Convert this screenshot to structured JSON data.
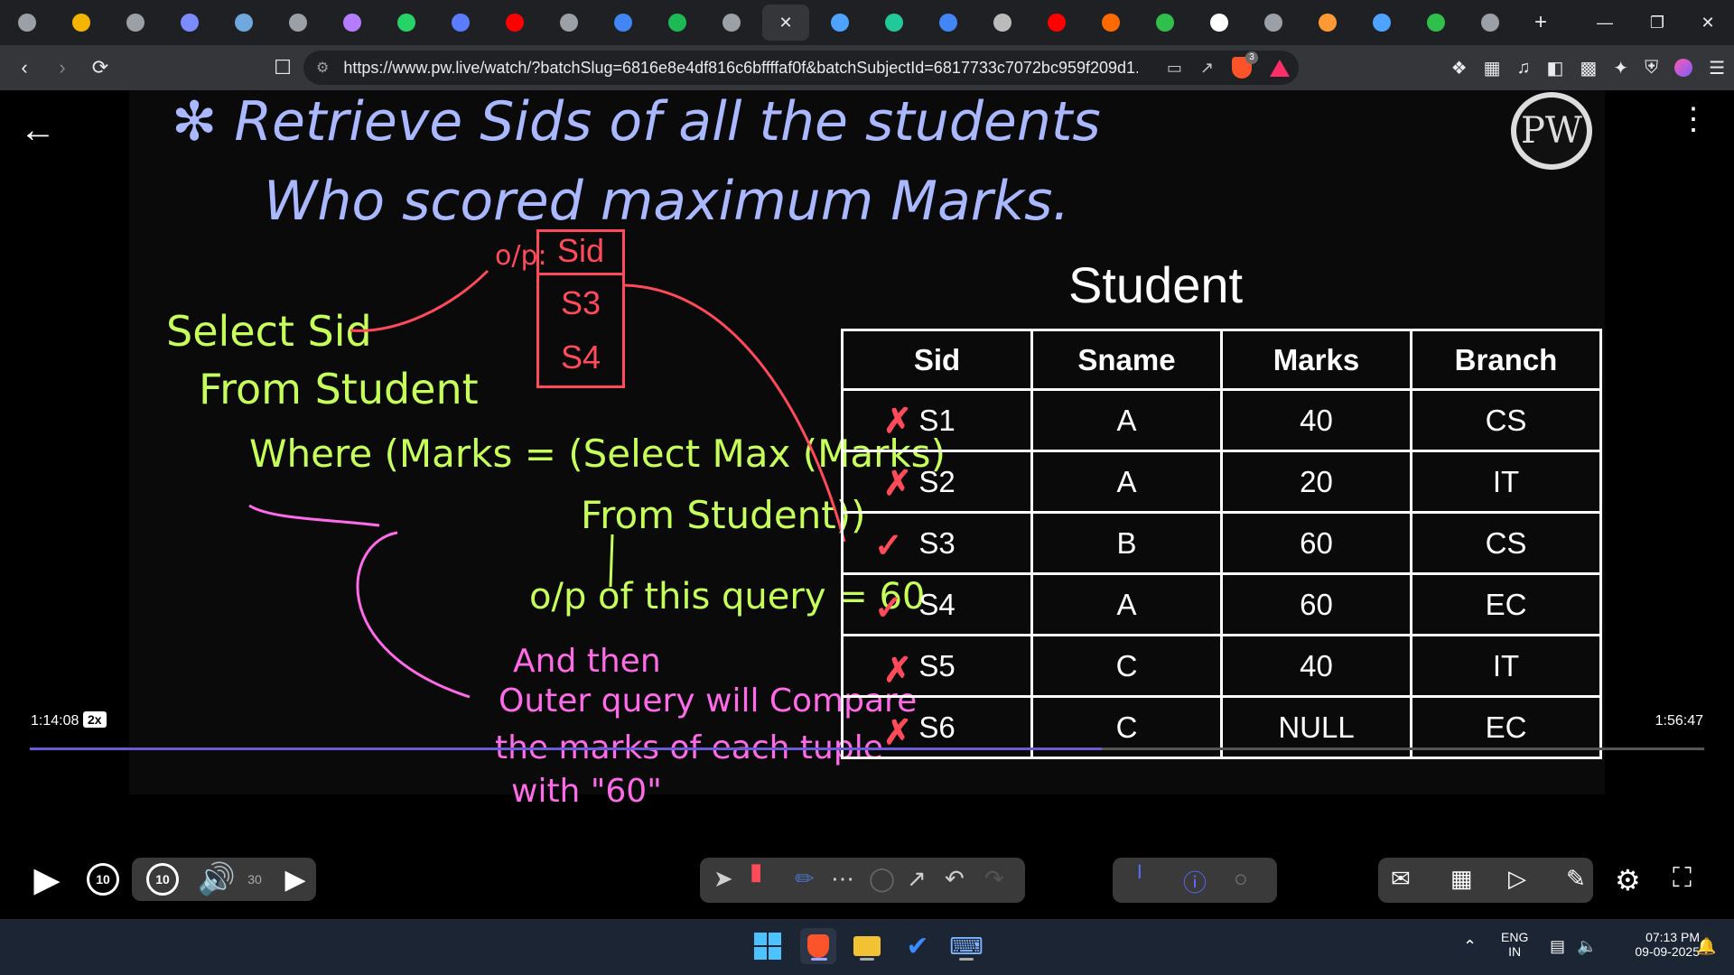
{
  "browser": {
    "tab_colors": [
      "#9aa0a6",
      "#f5b400",
      "#9aa0a6",
      "#7c8cff",
      "#6fa8dc",
      "#9aa0a6",
      "#b57cff",
      "#25d366",
      "#5b7cff",
      "#ff0000",
      "#9aa0a6",
      "#4285f4",
      "#1db954",
      "#9aa0a6"
    ],
    "active_tab_close": "✕",
    "tab_colors_right": [
      "#4da3ff",
      "#20c997",
      "#4285f4",
      "#bbbbbb",
      "#ff0000",
      "#ff6a00",
      "#2fbf4a",
      "#ffffff",
      "#9aa0a6",
      "#ff9933",
      "#4da3ff",
      "#2fbf4a",
      "#9aa0a6"
    ],
    "new_tab": "+",
    "window_controls": {
      "minimize": "—",
      "restore": "❐",
      "close": "✕"
    },
    "url": "https://www.pw.live/watch/?batchSlug=6816e8e4df816c6bffffaf0f&batchSubjectId=6817733c7072bc959f209d1...",
    "brave_badge": "3"
  },
  "lecture": {
    "heading_line1": "✻ Retrieve Sids of all the students",
    "heading_line2": "Who scored maximum Marks.",
    "logo": "PW",
    "query_line1": "Select Sid",
    "query_line2": "From Student",
    "query_line3": "Where (Marks = (Select Max (Marks)",
    "query_line4": "From Student))",
    "result_note": "o/p of this query = 60",
    "outer_note1": "And then",
    "outer_note2": "Outer query will Compare",
    "outer_note3": "the marks of each tuple",
    "outer_note4": "with \"60\"",
    "op_label": "o/p:",
    "op_header": "Sid",
    "op_values": [
      "S3",
      "S4"
    ],
    "table_title": "Student",
    "columns": [
      "Sid",
      "Sname",
      "Marks",
      "Branch"
    ],
    "rows": [
      {
        "sid": "S1",
        "sname": "A",
        "marks": "40",
        "branch": "CS",
        "mark": "✗"
      },
      {
        "sid": "S2",
        "sname": "A",
        "marks": "20",
        "branch": "IT",
        "mark": "✗"
      },
      {
        "sid": "S3",
        "sname": "B",
        "marks": "60",
        "branch": "CS",
        "mark": "✓"
      },
      {
        "sid": "S4",
        "sname": "A",
        "marks": "60",
        "branch": "EC",
        "mark": "✓"
      },
      {
        "sid": "S5",
        "sname": "C",
        "marks": "40",
        "branch": "IT",
        "mark": "✗"
      },
      {
        "sid": "S6",
        "sname": "C",
        "marks": "NULL",
        "branch": "EC",
        "mark": "✗"
      }
    ]
  },
  "player": {
    "current_time": "1:14:08",
    "speed": "2x",
    "duration": "1:56:47",
    "progress": 0.64,
    "rewind_label": "10",
    "forward_label": "10",
    "skip_label": "30"
  },
  "taskbar": {
    "language": "ENG",
    "region": "IN",
    "time": "07:13 PM",
    "date": "09-09-2025"
  }
}
